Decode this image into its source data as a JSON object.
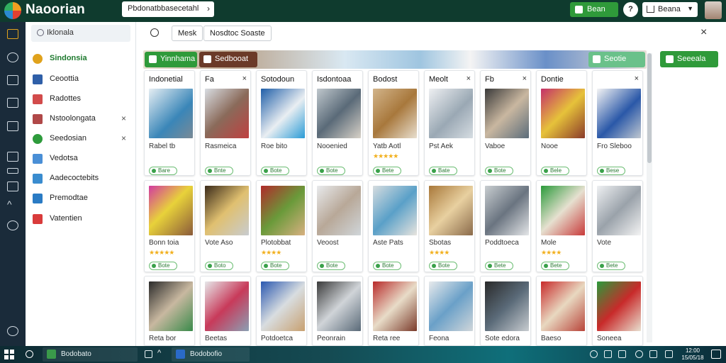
{
  "app": {
    "title": "Naoorian"
  },
  "topbar": {
    "search_value": "Pbdonatbbasecetahl",
    "green_button": "Bean",
    "help_label": "?",
    "user_menu": "Beana"
  },
  "sidebar": {
    "search_value": "Iklonala",
    "items": [
      {
        "label": "Sindonsia",
        "color": "#e0a21c"
      },
      {
        "label": "Ceoottia",
        "color": "#2f5fa8"
      },
      {
        "label": "Radottes",
        "color": "#d24b4b"
      },
      {
        "label": "Nstoolongata",
        "color": "#b04848"
      },
      {
        "label": "Seedosian",
        "color": "#2e9b3c"
      },
      {
        "label": "Vedotsa",
        "color": "#4a8fd6"
      },
      {
        "label": "Aadecoctebits",
        "color": "#3a8ccf"
      },
      {
        "label": "Premodtae",
        "color": "#2a7bc4"
      },
      {
        "label": "Vatentien",
        "color": "#d93b3b"
      }
    ]
  },
  "toolbar": {
    "chip_1": "Mesk",
    "chip_2": "Nosdtoc Soaste",
    "close_label": "×"
  },
  "banner": {
    "left_button": "Yinnhama",
    "mid_button": "Sedbooat",
    "right_button": "Seotie"
  },
  "right_action": "Seeeala",
  "cards_row1": [
    {
      "title": "Indonetial",
      "sub": "Rabel tb",
      "badge": "Bare",
      "x": "",
      "stars": ""
    },
    {
      "title": "Fa",
      "sub": "Rasmeica",
      "badge": "Bnte",
      "x": "×",
      "stars": ""
    },
    {
      "title": "Sotodoun",
      "sub": "Roe bito",
      "badge": "Bote",
      "x": "",
      "stars": ""
    },
    {
      "title": "Isdontoaa",
      "sub": "Nooenied",
      "badge": "Bote",
      "x": "",
      "stars": ""
    },
    {
      "title": "Bodost",
      "sub": "Yatb Aotl",
      "badge": "Bete",
      "x": "",
      "stars": "★★★★★"
    },
    {
      "title": "Meolt",
      "sub": "Pst Aek",
      "badge": "Bate",
      "x": "×",
      "stars": ""
    },
    {
      "title": "Fb",
      "sub": "Vaboe",
      "badge": "Bote",
      "x": "×",
      "stars": ""
    },
    {
      "title": "Dontie",
      "sub": "Nooe",
      "badge": "Bele",
      "x": "",
      "stars": ""
    },
    {
      "title": "",
      "sub": "Fro Sleboo",
      "badge": "Bese",
      "x": "×",
      "stars": ""
    }
  ],
  "cards_row2": [
    {
      "sub": "Bonn toia",
      "stars": "★★★★★",
      "badge": "Bote"
    },
    {
      "sub": "Vote Aso",
      "stars": "",
      "badge": "Boto"
    },
    {
      "sub": "Plotobbat",
      "stars": "★★★★",
      "badge": "Bote"
    },
    {
      "sub": "Veoost",
      "stars": "",
      "badge": "Bote"
    },
    {
      "sub": "Aste Pats",
      "stars": "",
      "badge": "Bote"
    },
    {
      "sub": "Sbotas",
      "stars": "★★★★",
      "badge": "Bote"
    },
    {
      "sub": "Poddtoeca",
      "stars": "",
      "badge": "Bete"
    },
    {
      "sub": "Mole",
      "stars": "★★★★",
      "badge": "Bete"
    },
    {
      "sub": "Vote",
      "stars": "",
      "badge": "Bete"
    }
  ],
  "cards_row3": [
    {
      "sub": "Reta bor"
    },
    {
      "sub": "Beetas"
    },
    {
      "sub": "Potdoetca"
    },
    {
      "sub": "Peonrain"
    },
    {
      "sub": "Reta ree"
    },
    {
      "sub": "Feona"
    },
    {
      "sub": "Sote edora"
    },
    {
      "sub": "Baeso"
    },
    {
      "sub": "Soneea"
    }
  ],
  "taskbar": {
    "app_1": "Bodobato",
    "app_2": "Bodobofio",
    "clock_line1": "12:00",
    "clock_line2": "15/05/18"
  }
}
